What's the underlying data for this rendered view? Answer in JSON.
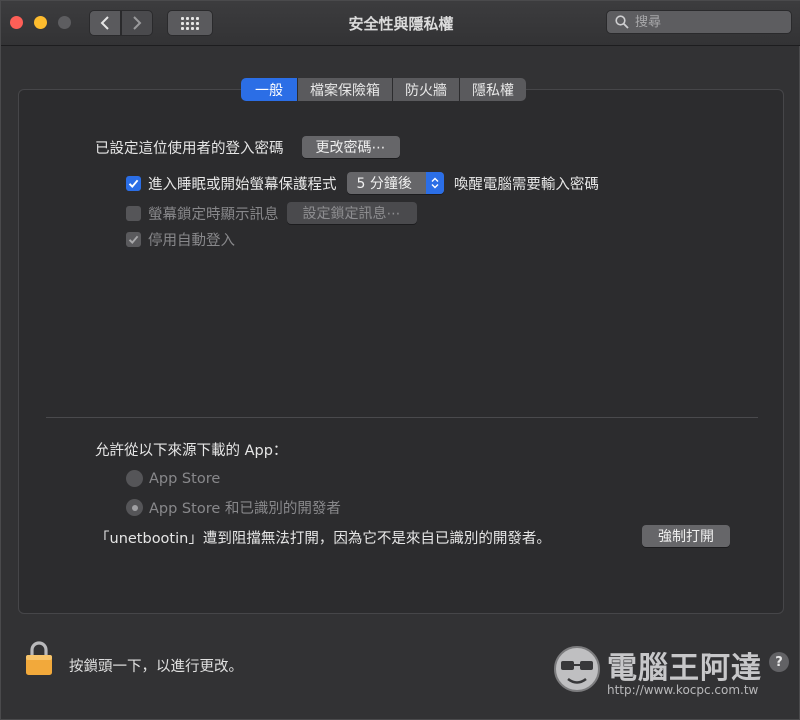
{
  "window": {
    "title": "安全性與隱私權",
    "search_placeholder": "搜尋"
  },
  "tabs": [
    {
      "label": "一般",
      "active": true
    },
    {
      "label": "檔案保險箱",
      "active": false
    },
    {
      "label": "防火牆",
      "active": false
    },
    {
      "label": "隱私權",
      "active": false
    }
  ],
  "general": {
    "password_label": "已設定這位使用者的登入密碼",
    "change_password_button": "更改密碼⋯",
    "require_password": {
      "checked": true,
      "label": "進入睡眠或開始螢幕保護程式",
      "delay_value": "5 分鐘後",
      "suffix": "喚醒電腦需要輸入密碼"
    },
    "show_message": {
      "checked": false,
      "enabled": false,
      "label": "螢幕鎖定時顯示訊息",
      "button": "設定鎖定訊息⋯"
    },
    "disable_autologin": {
      "checked": true,
      "enabled": false,
      "label": "停用自動登入"
    }
  },
  "download_sources": {
    "heading": "允許從以下來源下載的 App：",
    "options": [
      {
        "label": "App Store",
        "selected": false
      },
      {
        "label": "App Store 和已識別的開發者",
        "selected": true
      }
    ],
    "blocked_message": "「unetbootin」遭到阻擋無法打開，因為它不是來自已識別的開發者。",
    "open_anyway_button": "強制打開"
  },
  "footer": {
    "lock_text": "按鎖頭一下，以進行更改。",
    "help": "?"
  },
  "watermark": {
    "title": "電腦王阿達",
    "url": "http://www.kocpc.com.tw"
  },
  "colors": {
    "accent": "#2b6ee6",
    "window_bg": "#323234",
    "panel_bg": "#2c2c2e"
  }
}
